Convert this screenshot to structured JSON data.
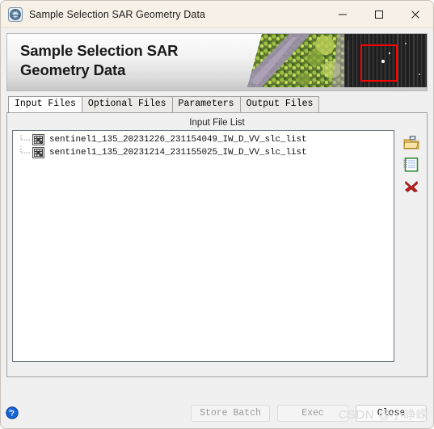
{
  "window": {
    "title": "Sample Selection SAR Geometry Data",
    "app_icon": "satellite-app-icon",
    "controls": {
      "minimize": "minimize-icon",
      "maximize": "maximize-icon",
      "close": "close-icon"
    },
    "titlebar_color": "#f7f0e6"
  },
  "banner": {
    "heading": "Sample Selection SAR\nGeometry Data",
    "image_alt": "aerial-optical-and-sar-thumbnail",
    "highlight_box_color": "#ff0000"
  },
  "tabs": [
    {
      "label": "Input Files",
      "active": true
    },
    {
      "label": "Optional Files",
      "active": false
    },
    {
      "label": "Parameters",
      "active": false
    },
    {
      "label": "Output Files",
      "active": false
    }
  ],
  "panel": {
    "label": "Input File List",
    "files": [
      {
        "name": "sentinel1_135_20231226_231154049_IW_D_VV_slc_list",
        "icon": "file-grid-icon"
      },
      {
        "name": "sentinel1_135_20231214_231155025_IW_D_VV_slc_list",
        "icon": "file-grid-icon"
      }
    ],
    "tools": [
      {
        "name": "open-folder-icon",
        "title": "Open"
      },
      {
        "name": "notepad-list-icon",
        "title": "Edit list"
      },
      {
        "name": "delete-red-x-icon",
        "title": "Remove"
      }
    ]
  },
  "footer": {
    "help_icon": "help-question-icon",
    "buttons": [
      {
        "label": "Store Batch",
        "enabled": false
      },
      {
        "label": "Exec",
        "enabled": false
      },
      {
        "label": "Close",
        "enabled": true
      }
    ]
  },
  "watermark": {
    "text": "CSDN @小峥嵘"
  }
}
